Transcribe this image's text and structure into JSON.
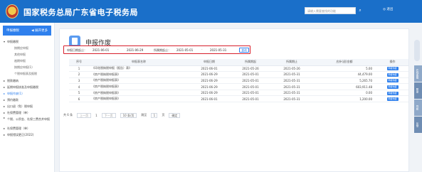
{
  "header": {
    "title": "国家税务总局广东省电子税务局",
    "search_placeholder": "请输入需要查找的功能",
    "search_icon": "search-icon",
    "user_text": "◎ 退出"
  },
  "sidebar": {
    "head_label": "申报缴税",
    "head_right": "◀ 展开更多",
    "items": [
      {
        "label": "申报缴税",
        "kind": "group",
        "arrow": "▾"
      },
      {
        "label": "按期应申报",
        "kind": "sub"
      },
      {
        "label": "其他申报",
        "kind": "sub"
      },
      {
        "label": "逾期申报",
        "kind": "sub"
      },
      {
        "label": "按期应申报(1)",
        "kind": "sub"
      },
      {
        "label": "个税申报表及报税",
        "kind": "sub"
      },
      {
        "label": "税款缴纳",
        "kind": "group",
        "arrow": "▸"
      },
      {
        "label": "延期申报核准及申报缴税",
        "kind": "group",
        "arrow": "▸"
      },
      {
        "label": "申报作废(1)",
        "kind": "group active",
        "arrow": "▸"
      },
      {
        "label": "预约缴款",
        "kind": "group",
        "arrow": "▸"
      },
      {
        "label": "出口退（免）税申报",
        "kind": "group",
        "arrow": "▸"
      },
      {
        "label": "社保费管理（单）",
        "kind": "group",
        "arrow": "▸"
      },
      {
        "label": "个税、公积金、社保三费合并申报",
        "kind": "group wrap",
        "arrow": "▸"
      },
      {
        "label": "社保费管理（单）",
        "kind": "group",
        "arrow": "▸"
      },
      {
        "label": "申报错误更正(2022)",
        "kind": "group",
        "arrow": "▸"
      }
    ]
  },
  "main": {
    "title": "申报作废",
    "filter": {
      "label1": "申报日期起止：",
      "date1_start": "2021-06-01",
      "date1_end": "2021-06-29",
      "label2": "所属期起止：",
      "date2_start": "2021-05-01",
      "date2_end": "2021-05-31",
      "sep": "-",
      "query_label": "查询"
    },
    "table": {
      "headers": [
        "序号",
        "申报表名称",
        "申报日期",
        "所属期起",
        "所属期止",
        "应补(退)金额",
        "操作"
      ],
      "rows": [
        {
          "no": "1",
          "name": "《印花税纳税申报（报告）表》",
          "date": "2021-06-01",
          "start": "2021-05-26",
          "end": "2021-05-26",
          "amount": "5.00",
          "op": "申报作废"
        },
        {
          "no": "2",
          "name": "《房产税纳税申报表》",
          "date": "2021-06-29",
          "start": "2021-05-01",
          "end": "2021-05-31",
          "amount": "44,479.00",
          "op": "申报作废"
        },
        {
          "no": "3",
          "name": "《房产税纳税申报表》",
          "date": "2021-06-29",
          "start": "2021-05-01",
          "end": "2021-05-31",
          "amount": "5,265.70",
          "op": "申报作废"
        },
        {
          "no": "4",
          "name": "《房产税纳税申报表》",
          "date": "2021-06-29",
          "start": "2021-05-01",
          "end": "2021-05-31",
          "amount": "603,911.48",
          "op": "申报作废"
        },
        {
          "no": "5",
          "name": "《房产税纳税申报表》",
          "date": "2021-06-29",
          "start": "2021-05-01",
          "end": "2021-05-31",
          "amount": "0.00",
          "op": "申报作废"
        },
        {
          "no": "6",
          "name": "《房产税纳税申报表》",
          "date": "2021-06-01",
          "start": "2021-05-01",
          "end": "2021-05-31",
          "amount": "1,200.00",
          "op": "申报作废"
        }
      ]
    },
    "pager": {
      "total": "共 6 条",
      "prev": "上一页",
      "page": "1",
      "next": "下一页",
      "size": "10 条/页",
      "goto_label": "跳至",
      "goto_value": "1",
      "goto_unit": "页",
      "go": "确定"
    }
  },
  "right_tabs": [
    "在线客服",
    "帮助",
    "导航",
    "反馈"
  ]
}
